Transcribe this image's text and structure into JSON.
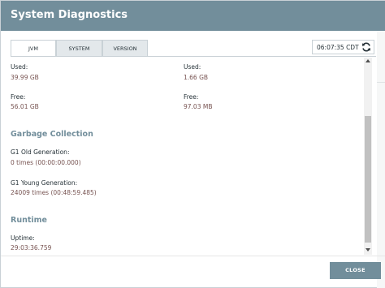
{
  "dialog": {
    "title": "System Diagnostics",
    "tabs": [
      {
        "label": "JVM",
        "active": true
      },
      {
        "label": "SYSTEM",
        "active": false
      },
      {
        "label": "VERSION",
        "active": false
      }
    ],
    "timestamp": "06:07:35 CDT",
    "close_label": "CLOSE"
  },
  "memory": {
    "heap": {
      "used_label": "Used:",
      "used_value": "39.99 GB",
      "free_label": "Free:",
      "free_value": "56.01 GB"
    },
    "non_heap": {
      "used_label": "Used:",
      "used_value": "1.66 GB",
      "free_label": "Free:",
      "free_value": "97.03 MB"
    }
  },
  "garbage_collection": {
    "title": "Garbage Collection",
    "old_label": "G1 Old Generation:",
    "old_value": "0 times (00:00:00.000)",
    "young_label": "G1 Young Generation:",
    "young_value": "24009 times (00:48:59.485)"
  },
  "runtime": {
    "title": "Runtime",
    "uptime_label": "Uptime:",
    "uptime_value": "29:03:36.759"
  },
  "colors": {
    "header": "#728e9b",
    "value_text": "#775351",
    "section_title": "#728e9b"
  }
}
